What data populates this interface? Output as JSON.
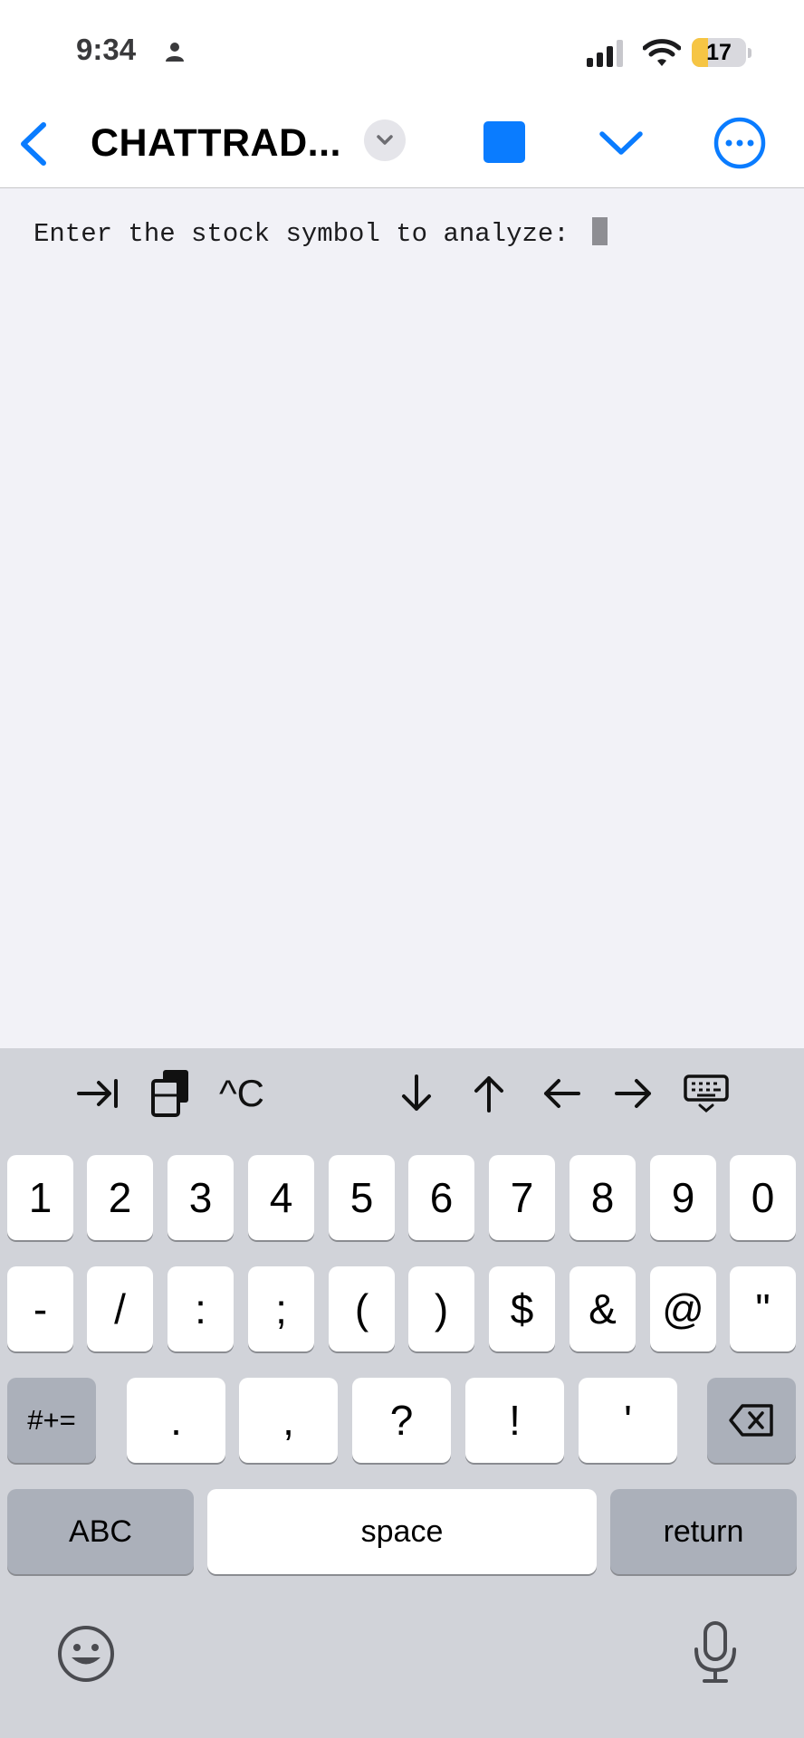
{
  "status_bar": {
    "time": "9:34",
    "battery_level": "17",
    "battery_fraction": 0.3
  },
  "nav": {
    "title": "CHATTRAD..."
  },
  "terminal": {
    "prompt": "Enter the stock symbol to analyze:"
  },
  "accessory_bar": {
    "ctrl_c_label": "^C"
  },
  "keyboard": {
    "row1": [
      "1",
      "2",
      "3",
      "4",
      "5",
      "6",
      "7",
      "8",
      "9",
      "0"
    ],
    "row2": [
      "-",
      "/",
      ":",
      ";",
      "(",
      ")",
      "$",
      "&",
      "@",
      "\""
    ],
    "row3": {
      "more_symbols": "#+=",
      "keys": [
        ".",
        ",",
        "?",
        "!",
        "'"
      ]
    },
    "row4": {
      "abc": "ABC",
      "space": "space",
      "return": "return"
    }
  },
  "colors": {
    "accent": "#0a7cff",
    "keyboard_bg": "#d1d3d9",
    "battery_low": "#f6c544"
  },
  "icons": [
    "person-icon",
    "signal-icon",
    "wifi-icon",
    "battery-icon",
    "back-chevron-icon",
    "chevron-down-icon",
    "stop-icon",
    "ellipsis-circle-icon",
    "tab-icon",
    "clipboard-icon",
    "arrow-down-icon",
    "arrow-up-icon",
    "arrow-left-icon",
    "arrow-right-icon",
    "keyboard-dismiss-icon",
    "backspace-icon",
    "emoji-icon",
    "microphone-icon"
  ]
}
